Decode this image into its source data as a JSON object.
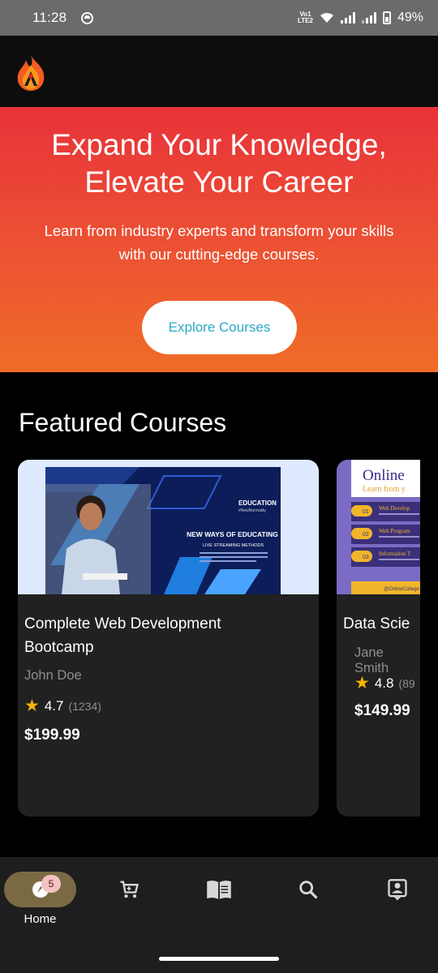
{
  "status_bar": {
    "time": "11:28",
    "volte_top": "Vo1",
    "volte_bottom": "LTE2",
    "battery": "49%"
  },
  "hero": {
    "title_line1": "Expand Your Knowledge,",
    "title_line2": "Elevate Your Career",
    "subtitle_line1": "Learn from industry experts and transform your skills",
    "subtitle_line2": "with our cutting-edge courses.",
    "cta_label": "Explore Courses"
  },
  "featured": {
    "title": "Featured Courses",
    "courses": [
      {
        "title_line1": "Complete Web Development",
        "title_line2": "Bootcamp",
        "instructor": "John Doe",
        "rating": "4.7",
        "reviews": "(1234)",
        "price": "$199.99",
        "thumb": {
          "brand": "EDUCATION",
          "tag": "#NewNormality",
          "headline": "NEW WAYS OF EDUCATING",
          "subhead": "LIVE STREAMING METHODS"
        }
      },
      {
        "title_line1": "Data Scie",
        "instructor": "Jane Smith",
        "rating": "4.8",
        "reviews": "(89",
        "price": "$149.99",
        "thumb": {
          "heading": "Online",
          "subheading": "Learn from y",
          "items": [
            {
              "num": "01",
              "label": "Web Develop"
            },
            {
              "num": "02",
              "label": "Web Program"
            },
            {
              "num": "03",
              "label": "Information T"
            }
          ],
          "footer": "@OnlineCollege"
        }
      }
    ]
  },
  "bottom_nav": {
    "home_label": "Home",
    "badge_count": "5",
    "items": [
      "home-icon",
      "cart-icon",
      "book-icon",
      "search-icon",
      "profile-icon"
    ]
  },
  "colors": {
    "hero_top": "#e83239",
    "hero_bottom": "#ef6d28",
    "cta_text": "#2ba8c9",
    "star": "#f5b400",
    "home_pill": "#7a6a44"
  }
}
